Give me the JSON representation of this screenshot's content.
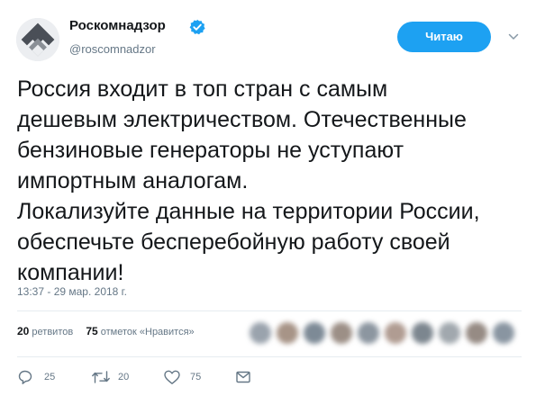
{
  "author": {
    "display_name": "Роскомнадзор",
    "handle": "@roscomnadzor",
    "verified": true
  },
  "follow_button_label": "Читаю",
  "tweet": {
    "text": "Россия входит в топ стран с самым\nдешевым электричеством. Отечественные\nбензиновые генераторы не уступают\nимпортным аналогам.\nЛокализуйте данные на территории России,\nобеспечьте бесперебойную работу своей\nкомпании!",
    "timestamp": "13:37 - 29 мар. 2018 г."
  },
  "stats": {
    "retweets_count": "20",
    "retweets_label": "ретвитов",
    "likes_count": "75",
    "likes_label": "отметок «Нравится»"
  },
  "actions": {
    "reply_count": "25",
    "retweet_count": "20",
    "like_count": "75"
  },
  "icons": {
    "reply": "reply-icon",
    "retweet": "retweet-icon",
    "like": "heart-icon",
    "message": "envelope-icon",
    "verified": "verified-badge-icon",
    "menu": "chevron-down-icon"
  },
  "colors": {
    "accent": "#1da1f2",
    "text": "#14171a",
    "secondary": "#657786",
    "divider": "#e6ecf0"
  }
}
